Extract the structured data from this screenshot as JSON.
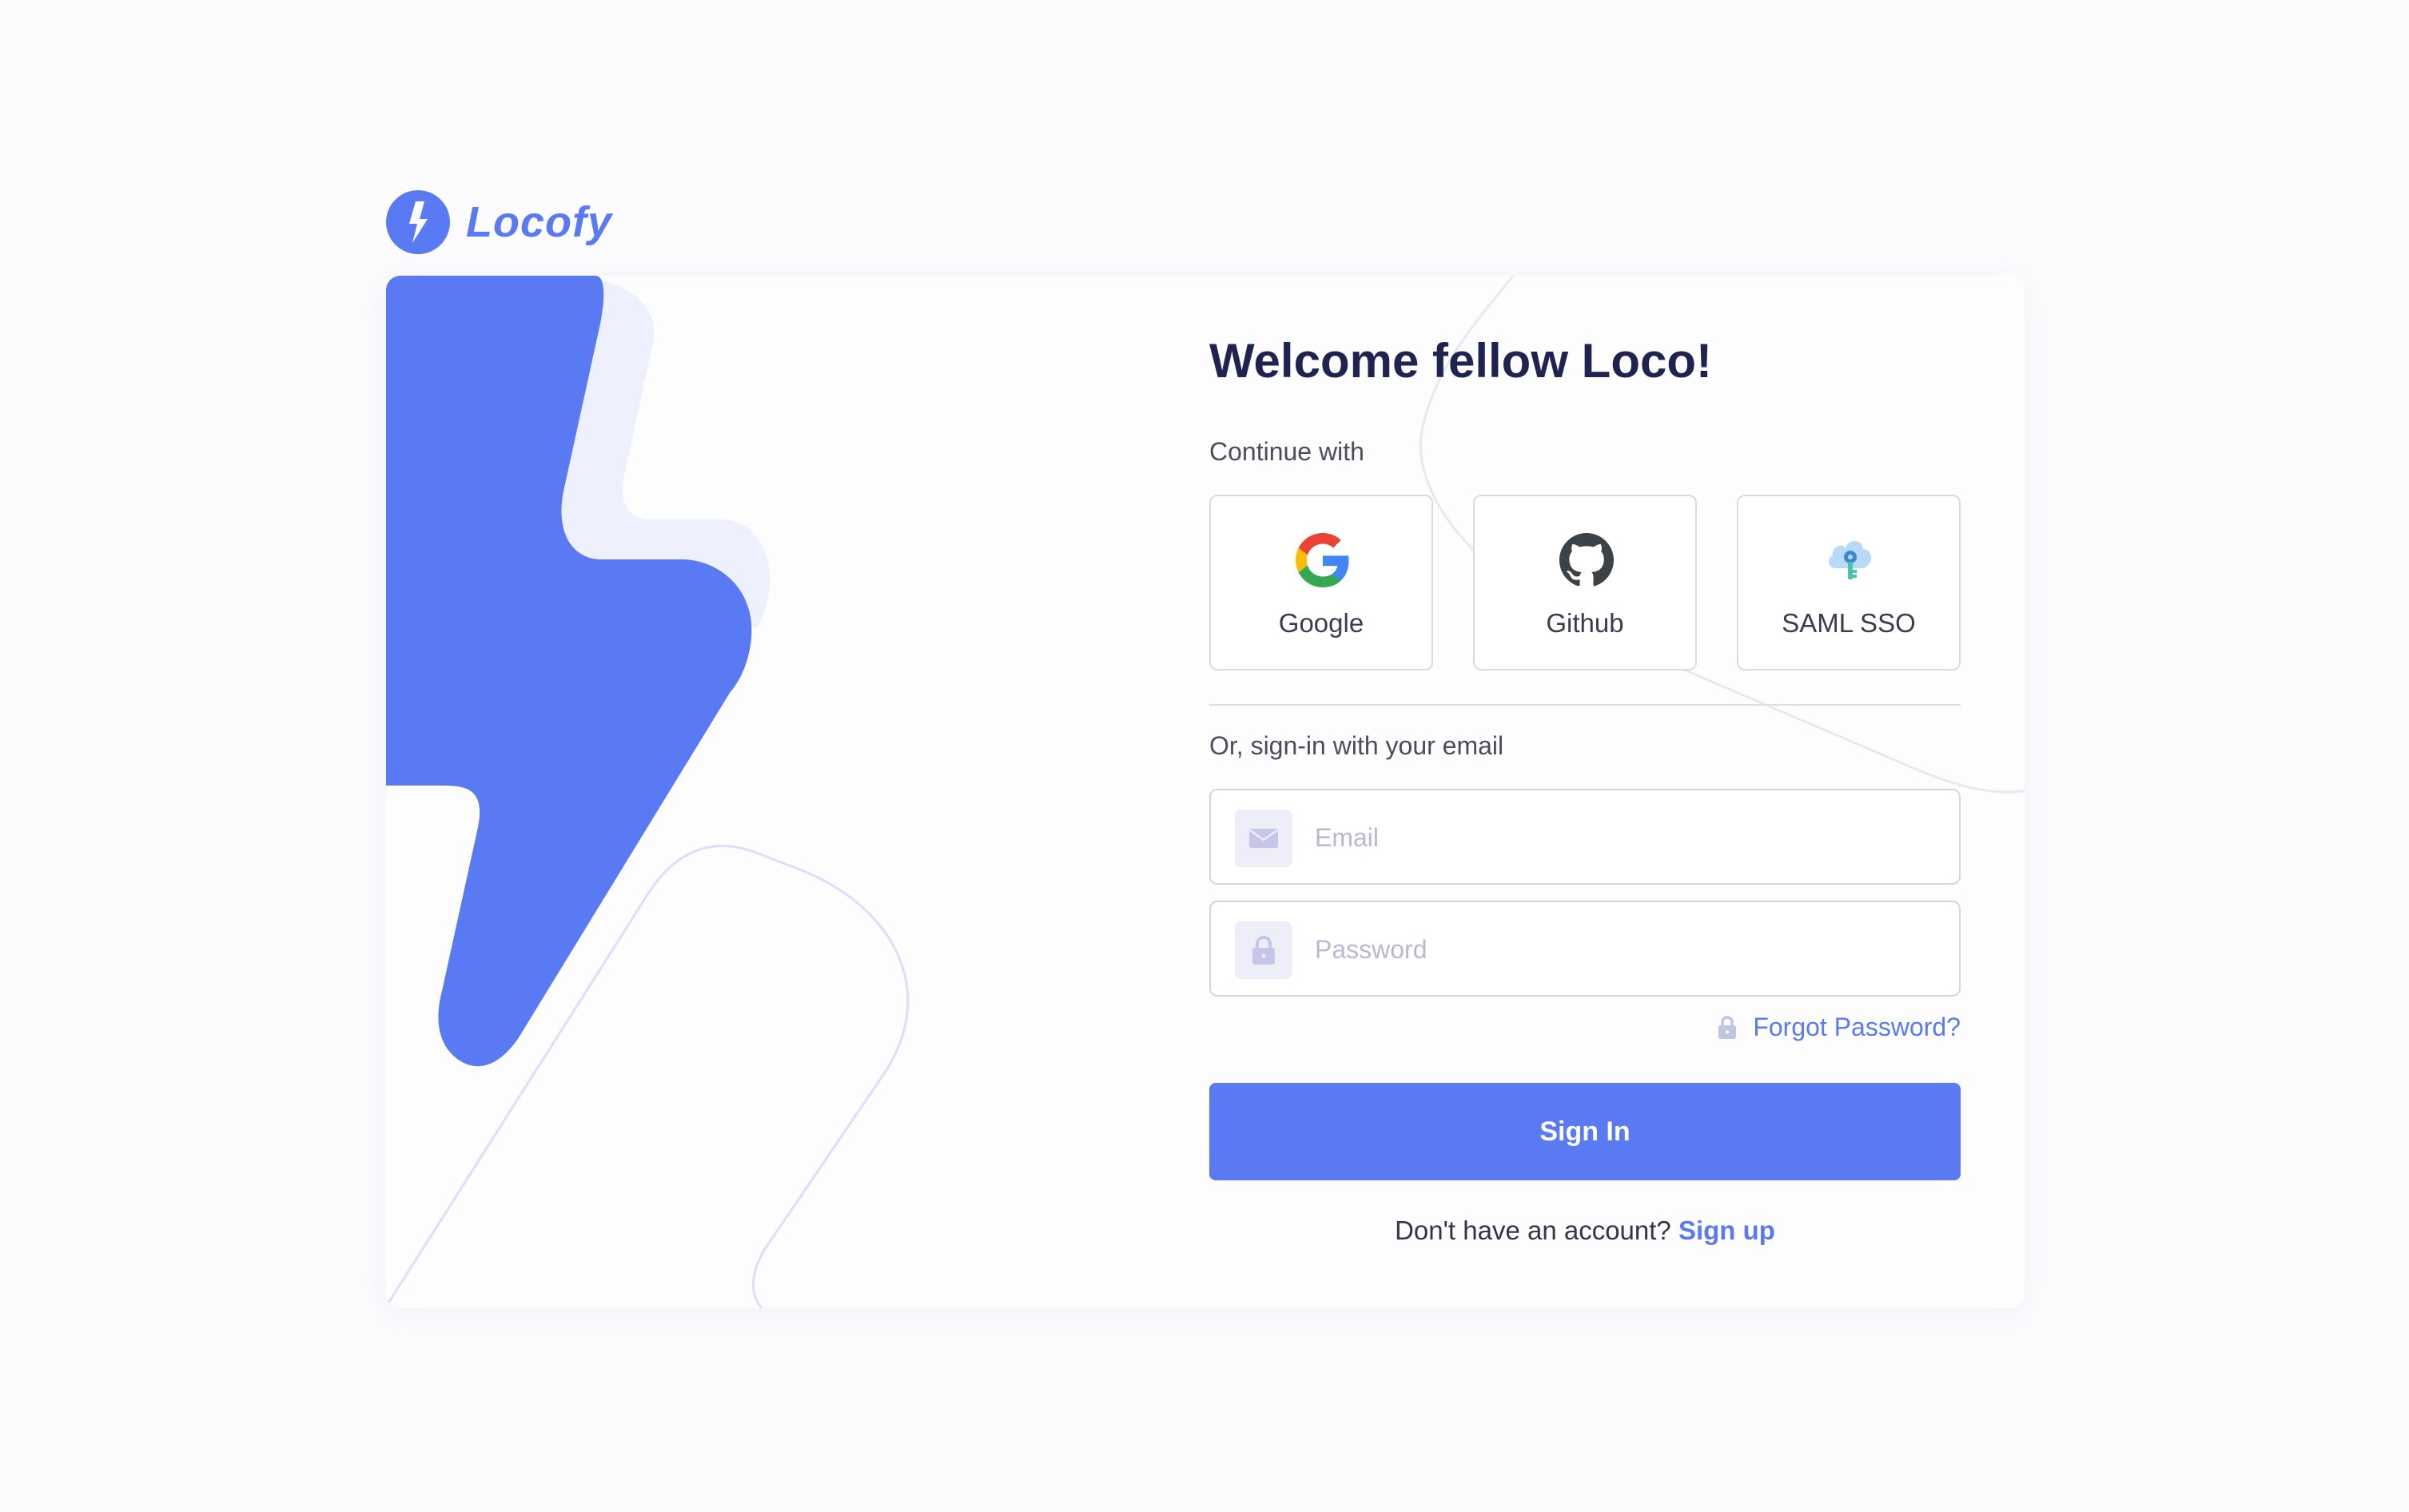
{
  "brand": {
    "name": "Locofy",
    "logo_icon": "lightning-bolt-icon",
    "accent_color": "#5a7af4"
  },
  "login": {
    "title": "Welcome fellow Loco!",
    "continue_label": "Continue with",
    "providers": [
      {
        "label": "Google",
        "icon": "google-icon"
      },
      {
        "label": "Github",
        "icon": "github-icon"
      },
      {
        "label": "SAML SSO",
        "icon": "cloud-key-icon"
      }
    ],
    "email_section_label": "Or, sign-in with your email",
    "email": {
      "placeholder": "Email",
      "value": "",
      "icon": "envelope-icon"
    },
    "password": {
      "placeholder": "Password",
      "value": "",
      "icon": "lock-icon"
    },
    "forgot_label": "Forgot Password?",
    "signin_label": "Sign In",
    "signup_prompt": "Don't have an account?",
    "signup_link": "Sign up"
  },
  "colors": {
    "title": "#1e2350",
    "bolt_fill": "#5a7af4",
    "bolt_shadow": "#eef0fd",
    "background": "#fcfbfd"
  }
}
